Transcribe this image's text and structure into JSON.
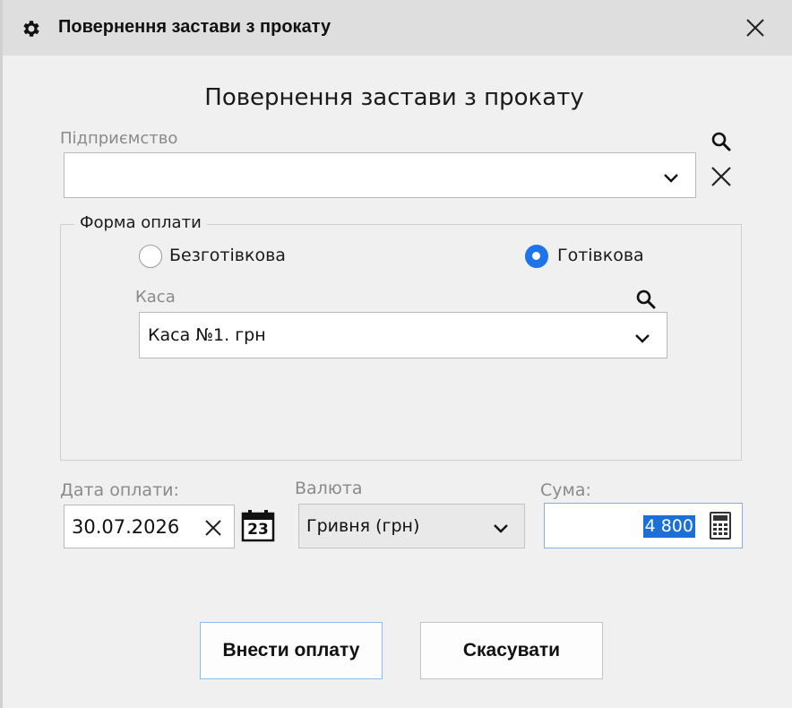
{
  "window": {
    "title": "Повернення застави з прокату",
    "heading": "Повернення застави з прокату"
  },
  "enterprise": {
    "label": "Підприємство",
    "value": ""
  },
  "payment_form": {
    "legend": "Форма оплати",
    "options": [
      {
        "label": "Безготівкова",
        "selected": false
      },
      {
        "label": "Готівкова",
        "selected": true
      }
    ],
    "cashbox_label": "Каса",
    "cashbox_value": "Каса №1. грн"
  },
  "payment_date": {
    "label": "Дата оплати:",
    "value": "30.07.2026",
    "calendar_day": "23"
  },
  "currency": {
    "label": "Валюта",
    "value": "Гривня (грн)"
  },
  "sum": {
    "label": "Сума:",
    "value": "4 800"
  },
  "buttons": {
    "submit": "Внести оплату",
    "cancel": "Скасувати"
  },
  "icons": {
    "gear": "gear-icon",
    "close": "close-icon",
    "search": "search-icon",
    "clear": "clear-icon",
    "chevron": "chevron-down-icon",
    "calendar": "calendar-icon",
    "calculator": "calculator-icon"
  },
  "colors": {
    "accent": "#1e74e8",
    "selection": "#1b6fd6",
    "focus_border": "#7fb0e8"
  }
}
